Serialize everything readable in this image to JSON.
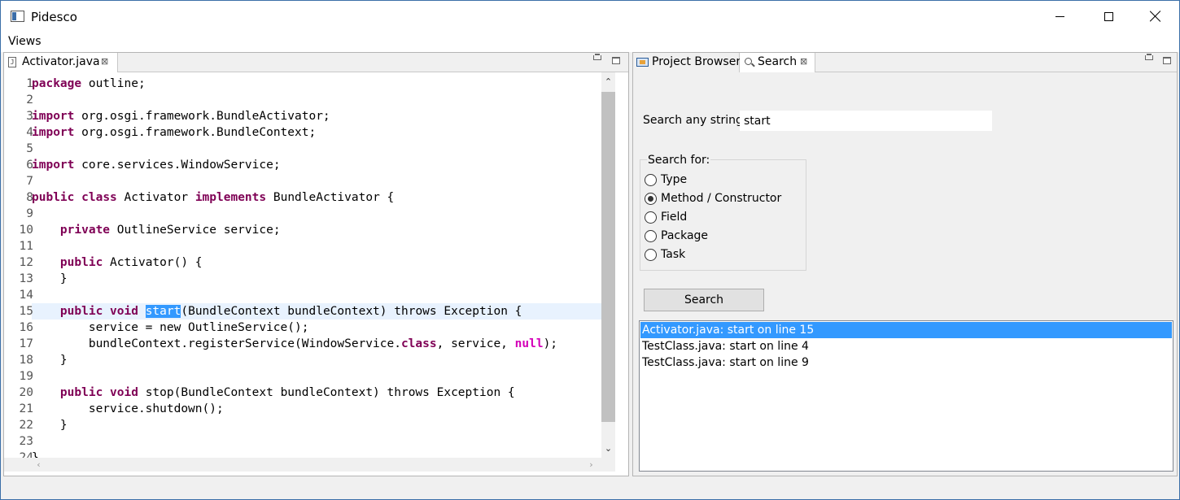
{
  "window": {
    "title": "Pidesco",
    "controls": [
      "minimize",
      "maximize",
      "close"
    ]
  },
  "menu": {
    "items": [
      "Views"
    ]
  },
  "editor": {
    "tab": {
      "label": "Activator.java",
      "icon": "java-file-icon",
      "close": "⊠"
    },
    "selection": "start",
    "highlighted_line": 15,
    "lines": [
      {
        "num": "1",
        "text": "package outline;"
      },
      {
        "num": "2",
        "text": ""
      },
      {
        "num": "3",
        "text": "import org.osgi.framework.BundleActivator;"
      },
      {
        "num": "4",
        "text": "import org.osgi.framework.BundleContext;"
      },
      {
        "num": "5",
        "text": ""
      },
      {
        "num": "6",
        "text": "import core.services.WindowService;"
      },
      {
        "num": "7",
        "text": ""
      },
      {
        "num": "8",
        "text": "public class Activator implements BundleActivator {"
      },
      {
        "num": "9",
        "text": ""
      },
      {
        "num": "10",
        "text": "    private OutlineService service;"
      },
      {
        "num": "11",
        "text": ""
      },
      {
        "num": "12",
        "text": "    public Activator() {"
      },
      {
        "num": "13",
        "text": "    }"
      },
      {
        "num": "14",
        "text": ""
      },
      {
        "num": "15",
        "text": "    public void start(BundleContext bundleContext) throws Exception {"
      },
      {
        "num": "16",
        "text": "        service = new OutlineService();"
      },
      {
        "num": "17",
        "text": "        bundleContext.registerService(WindowService.class, service, null);"
      },
      {
        "num": "18",
        "text": "    }"
      },
      {
        "num": "19",
        "text": ""
      },
      {
        "num": "20",
        "text": "    public void stop(BundleContext bundleContext) throws Exception {"
      },
      {
        "num": "21",
        "text": "        service.shutdown();"
      },
      {
        "num": "22",
        "text": "    }"
      },
      {
        "num": "23",
        "text": ""
      },
      {
        "num": "24",
        "text": "}"
      }
    ]
  },
  "right_panel": {
    "tabs": [
      {
        "label": "Project Browser",
        "icon": "project-browser-icon"
      },
      {
        "label": "Search",
        "icon": "search-icon",
        "close": "⊠"
      }
    ],
    "search": {
      "label": "Search any string:",
      "value": "start",
      "group_label": "Search for:",
      "options": [
        {
          "label": "Type",
          "checked": false
        },
        {
          "label": "Method / Constructor",
          "checked": true
        },
        {
          "label": "Field",
          "checked": false
        },
        {
          "label": "Package",
          "checked": false
        },
        {
          "label": "Task",
          "checked": false
        }
      ],
      "button_label": "Search",
      "results": [
        {
          "text": "Activator.java: start on line 15",
          "selected": true
        },
        {
          "text": "TestClass.java: start on line 4",
          "selected": false
        },
        {
          "text": "TestClass.java: start on line 9",
          "selected": false
        }
      ]
    }
  },
  "colors": {
    "keyword": "#7f0055",
    "null_keyword": "#d400b8",
    "selection": "#3399ff",
    "current_line": "#e8f2fe"
  }
}
